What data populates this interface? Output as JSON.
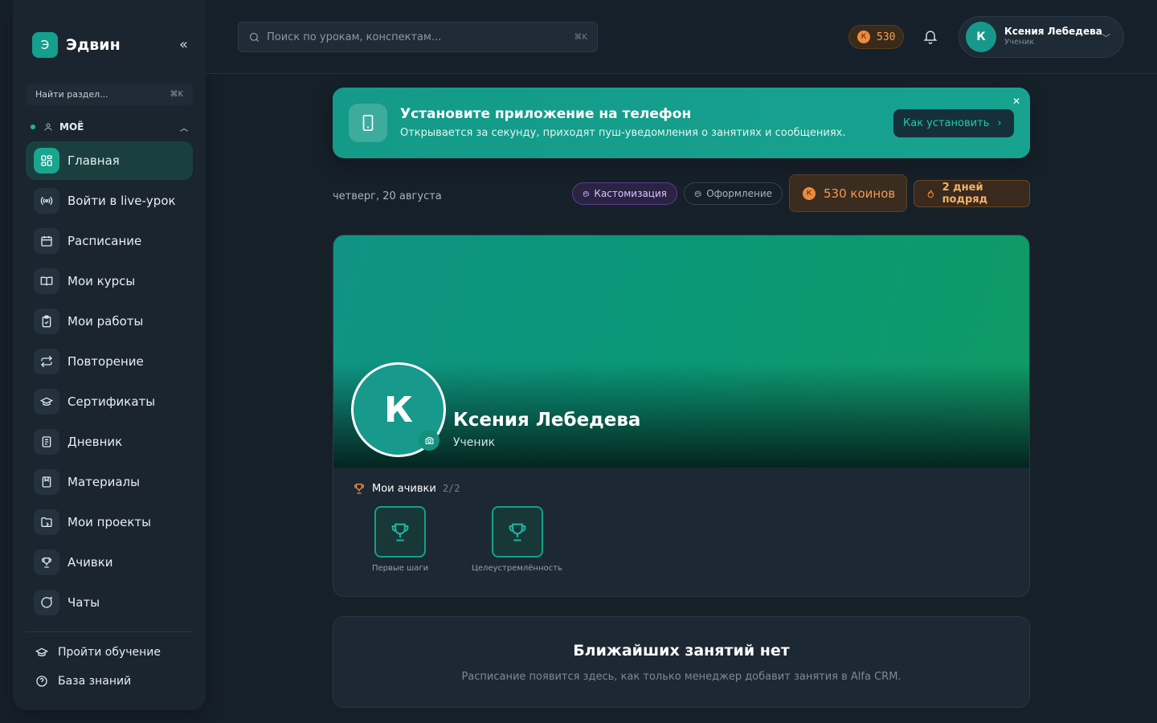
{
  "brand": {
    "logo_letter": "Э",
    "name": "Эдвин",
    "collapse_glyph": "«"
  },
  "sidebar": {
    "search_placeholder": "Найти раздел...",
    "search_shortcut": "⌘K",
    "section_title": "МОЁ",
    "items": [
      {
        "label": "Главная",
        "icon": "grid-icon",
        "active": true
      },
      {
        "label": "Войти в live-урок",
        "icon": "broadcast-icon"
      },
      {
        "label": "Расписание",
        "icon": "calendar-icon"
      },
      {
        "label": "Мои курсы",
        "icon": "book-open-icon"
      },
      {
        "label": "Мои работы",
        "icon": "clipboard-check-icon"
      },
      {
        "label": "Повторение",
        "icon": "repeat-icon"
      },
      {
        "label": "Сертификаты",
        "icon": "graduation-cap-icon"
      },
      {
        "label": "Дневник",
        "icon": "notebook-icon"
      },
      {
        "label": "Материалы",
        "icon": "bookmark-book-icon"
      },
      {
        "label": "Мои проекты",
        "icon": "folder-icon"
      },
      {
        "label": "Ачивки",
        "icon": "trophy-icon"
      },
      {
        "label": "Чаты",
        "icon": "chat-icon"
      }
    ],
    "footer": [
      {
        "label": "Пройти обучение",
        "icon": "graduation-cap-icon"
      },
      {
        "label": "База знаний",
        "icon": "help-circle-icon"
      }
    ]
  },
  "topbar": {
    "search_placeholder": "Поиск по урокам, конспектам...",
    "search_shortcut": "⌘K",
    "coins": "530",
    "coin_symbol": "К",
    "user": {
      "initial": "К",
      "name": "Ксения Лебедева",
      "role": "Ученик"
    }
  },
  "banner": {
    "title": "Установите приложение на телефон",
    "subtitle": "Открывается за секунду, приходят пуш-уведомления о занятиях и сообщениях.",
    "button": "Как установить",
    "close": "✕"
  },
  "info": {
    "date": "четверг, 20 августа",
    "customize": "Кастомизация",
    "theme": "Оформление",
    "coins": "530 коинов",
    "streak": "2 дней подряд"
  },
  "profile": {
    "initial": "К",
    "name": "Ксения Лебедева",
    "role": "Ученик",
    "achievements_title": "Мои ачивки",
    "achievements_count": "2/2",
    "achievements": [
      {
        "label": "Первые шаги"
      },
      {
        "label": "Целеустремлённость"
      }
    ]
  },
  "lessons": {
    "title": "Ближайших занятий нет",
    "subtitle": "Расписание появится здесь, как только менеджер добавит занятия в Alfa CRM."
  },
  "colors": {
    "accent": "#14a08c",
    "coin": "#f08a3a",
    "background": "#162029"
  }
}
